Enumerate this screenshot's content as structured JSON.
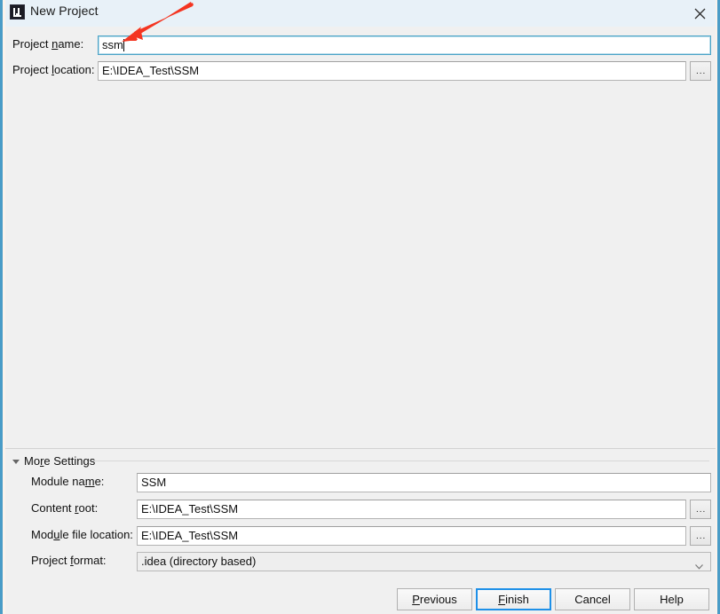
{
  "window": {
    "title": "New Project",
    "icon": "intellij-idea-logo",
    "close_label": "×"
  },
  "main_form": {
    "fields": [
      {
        "label_before": "Project ",
        "label_mnemonic": "n",
        "label_after": "ame:",
        "value": "ssm",
        "focused": true,
        "has_browse": false
      },
      {
        "label_before": "Project ",
        "label_mnemonic": "l",
        "label_after": "ocation:",
        "value": "E:\\IDEA_Test\\SSM",
        "focused": false,
        "has_browse": true
      }
    ],
    "browse_label": "..."
  },
  "more_settings": {
    "header_before": "Mo",
    "header_mnemonic": "r",
    "header_after": "e Settings",
    "expanded": true,
    "fields": [
      {
        "label_before": "Module na",
        "label_mnemonic": "m",
        "label_after": "e:",
        "value": "SSM",
        "has_browse": false
      },
      {
        "label_before": "Content ",
        "label_mnemonic": "r",
        "label_after": "oot:",
        "value": "E:\\IDEA_Test\\SSM",
        "has_browse": true
      },
      {
        "label_before": "Mod",
        "label_mnemonic": "u",
        "label_after": "le file location:",
        "value": "E:\\IDEA_Test\\SSM",
        "has_browse": true
      }
    ],
    "project_format": {
      "label_before": "Project ",
      "label_mnemonic": "f",
      "label_after": "ormat:",
      "selected": ".idea (directory based)",
      "options": [
        ".idea (directory based)"
      ]
    }
  },
  "buttons": [
    {
      "before": "",
      "mnemonic": "P",
      "after": "revious",
      "default": false
    },
    {
      "before": "",
      "mnemonic": "F",
      "after": "inish",
      "default": true
    },
    {
      "before": "Cancel",
      "mnemonic": "",
      "after": "",
      "default": false
    },
    {
      "before": "Help",
      "mnemonic": "",
      "after": "",
      "default": false
    }
  ],
  "annotation": {
    "type": "red-arrow",
    "color": "#f43521",
    "points_to": "project-name-input"
  }
}
